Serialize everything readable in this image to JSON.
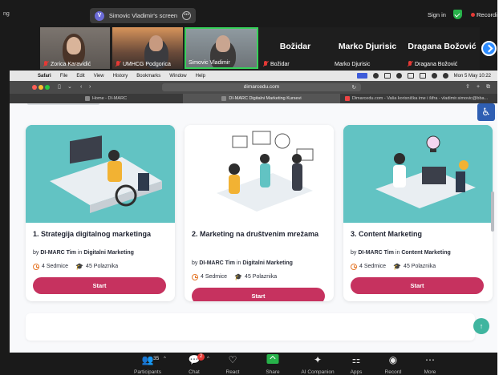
{
  "zoom": {
    "left_label": "ng",
    "share_badge": "V",
    "share_title": "Simovic Vladimir's screen",
    "sign_in": "Sign in",
    "recording": "Recording"
  },
  "participants": [
    {
      "name": "Zorica Karavidić",
      "muted": true
    },
    {
      "name": "UMHCG Podgorica",
      "muted": true
    },
    {
      "name": "Simovic Vladimir",
      "muted": false,
      "active_speaker": true
    },
    {
      "display": "Božidar",
      "name": "Božidar",
      "muted": true
    },
    {
      "display": "Marko Djurisic",
      "name": "Marko Djurisic",
      "muted": false
    },
    {
      "display": "Dragana Božović",
      "name": "Dragana Božović",
      "muted": true
    }
  ],
  "mac_menu": {
    "app": "Safari",
    "items": [
      "File",
      "Edit",
      "View",
      "History",
      "Bookmarks",
      "Window",
      "Help"
    ],
    "clock": "Mon 5 May  10:22"
  },
  "browser": {
    "url": "dimarcedu.com",
    "tabs": [
      {
        "label": "Home - DI-MARC",
        "active": false
      },
      {
        "label": "DI-MARC Digitalni Marketing Kursevi",
        "active": true
      },
      {
        "label": "Dimarcedu.com - Vaša korisnička ime i šifra - vladimir.simovic@bba...",
        "active": false
      }
    ]
  },
  "courses": [
    {
      "title": "1. Strategija digitalnog marketinga",
      "by_prefix": "by",
      "author": "DI-MARC Tim",
      "in_label": "in",
      "category": "Digitalni Marketing",
      "duration": "4 Sedmice",
      "students": "45 Polaznika",
      "button": "Start"
    },
    {
      "title": "2. Marketing na društvenim mrežama",
      "by_prefix": "by",
      "author": "DI-MARC Tim",
      "in_label": "in",
      "category": "Digitalni Marketing",
      "duration": "4 Sedmice",
      "students": "45 Polaznika",
      "button": "Start"
    },
    {
      "title": "3. Content Marketing",
      "by_prefix": "by",
      "author": "DI-MARC Tim",
      "in_label": "in",
      "category": "Content Marketing",
      "duration": "4 Sedmice",
      "students": "45 Polaznika",
      "button": "Start"
    }
  ],
  "controls": {
    "participants_label": "Participants",
    "participants_count": "35",
    "chat_label": "Chat",
    "chat_badge": "2",
    "react_label": "React",
    "share_label": "Share",
    "ai_label": "AI Companion",
    "apps_label": "Apps",
    "record_label": "Record",
    "more_label": "More"
  },
  "colors": {
    "zoom_bg": "#1a1a1a",
    "active_speaker": "#37d05a",
    "course_teal": "#62c3c3",
    "start_button": "#c6325f",
    "accent_orange": "#e5782a",
    "recording_red": "#e53935"
  }
}
